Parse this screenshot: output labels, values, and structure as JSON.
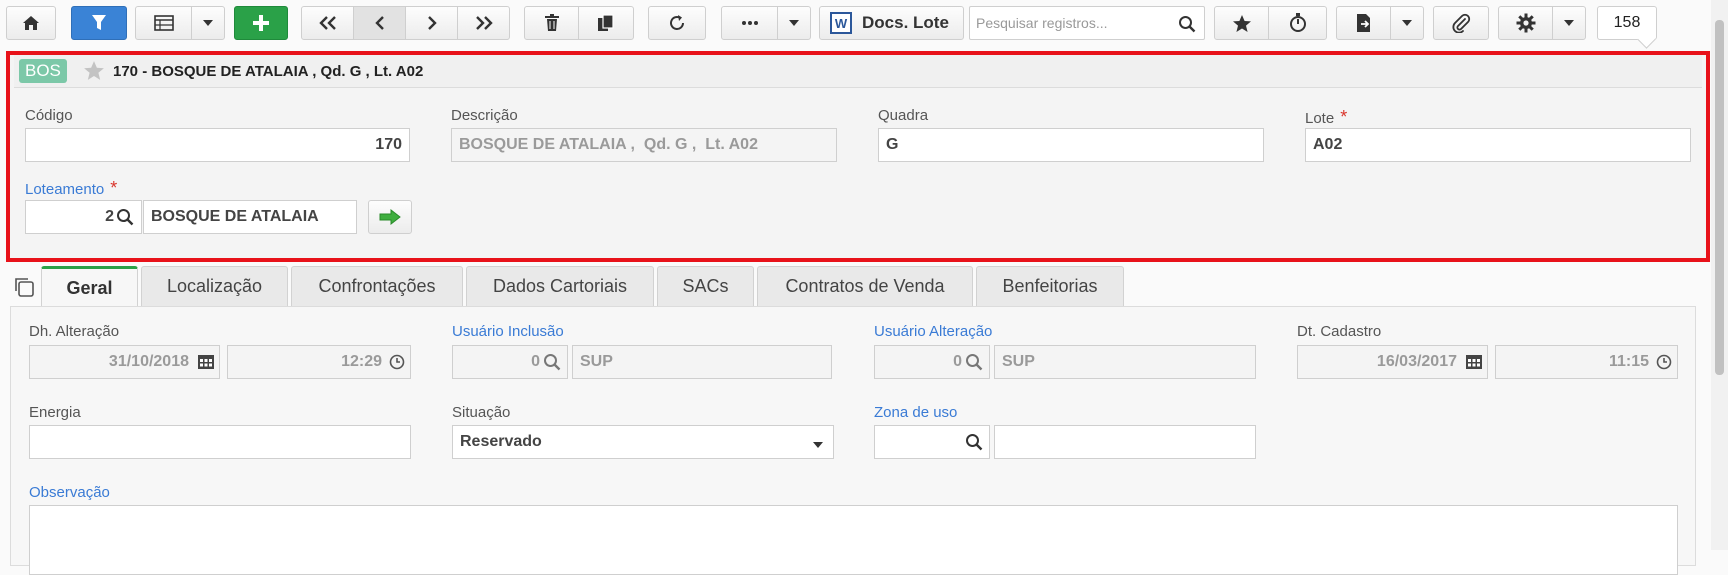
{
  "toolbar": {
    "icons": [
      "home-icon",
      "filter-icon",
      "table-icon",
      "add-icon",
      "first-icon",
      "prev-icon",
      "next-icon",
      "last-icon",
      "delete-icon",
      "copy-icon",
      "refresh-icon",
      "more-icon",
      "word-icon",
      "star-icon",
      "timer-icon",
      "export-icon",
      "attach-icon",
      "gear-icon"
    ],
    "docs_label": "Docs. Lote",
    "search_placeholder": "Pesquisar registros...",
    "record_count": "158",
    "colors": {
      "filter": "#3a83d6",
      "add": "#2aa148"
    }
  },
  "header": {
    "badge": "BOS",
    "title": "170 - BOSQUE DE ATALAIA , Qd. G , Lt. A02",
    "border_color": "#e8121a"
  },
  "form": {
    "codigo_label": "Código",
    "codigo_value": "170",
    "descricao_label": "Descrição",
    "descricao_value": "BOSQUE DE ATALAIA ,  Qd. G ,  Lt. A02",
    "quadra_label": "Quadra",
    "quadra_value": "G",
    "lote_label": "Lote",
    "lote_value": "A02",
    "loteamento_label": "Loteamento",
    "loteamento_code": "2",
    "loteamento_name": "BOSQUE DE ATALAIA",
    "required_mark": "*"
  },
  "tabs": [
    "Geral",
    "Localização",
    "Confrontações",
    "Dados Cartoriais",
    "SACs",
    "Contratos de Venda",
    "Benfeitorias"
  ],
  "active_tab": "Geral",
  "geral": {
    "dh_alteracao_label": "Dh. Alteração",
    "dh_alteracao_date": "31/10/2018",
    "dh_alteracao_time": "12:29",
    "usuario_inclusao_label": "Usuário Inclusão",
    "usuario_inclusao_code": "0",
    "usuario_inclusao_name": "SUP",
    "usuario_alteracao_label": "Usuário Alteração",
    "usuario_alteracao_code": "0",
    "usuario_alteracao_name": "SUP",
    "dt_cadastro_label": "Dt. Cadastro",
    "dt_cadastro_date": "16/03/2017",
    "dt_cadastro_time": "11:15",
    "energia_label": "Energia",
    "energia_value": "",
    "situacao_label": "Situação",
    "situacao_value": "Reservado",
    "zona_label": "Zona de uso",
    "observacao_label": "Observação"
  }
}
